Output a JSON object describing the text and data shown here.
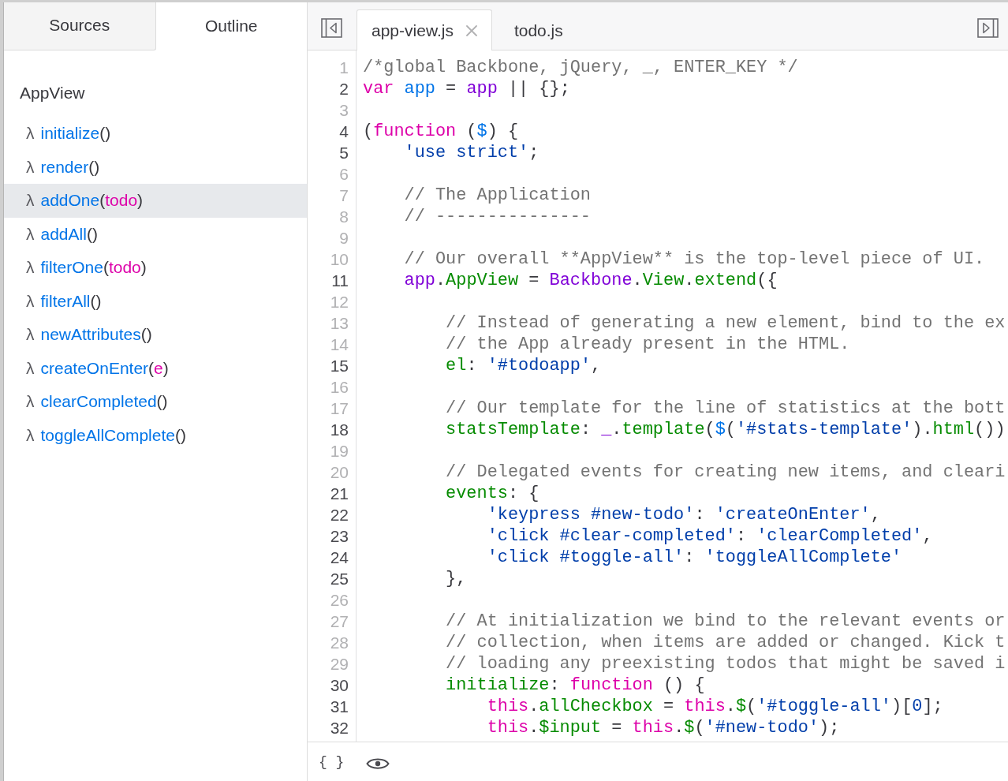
{
  "sidebar": {
    "tabs": [
      {
        "label": "Sources",
        "selected": false
      },
      {
        "label": "Outline",
        "selected": true
      }
    ],
    "outline": {
      "heading": "AppView",
      "functions": [
        {
          "symbol": "λ",
          "selected": false,
          "signature": [
            {
              "kind": "name",
              "text": "initialize"
            },
            {
              "kind": "punct",
              "text": "()"
            }
          ]
        },
        {
          "symbol": "λ",
          "selected": false,
          "signature": [
            {
              "kind": "name",
              "text": "render"
            },
            {
              "kind": "punct",
              "text": "()"
            }
          ]
        },
        {
          "symbol": "λ",
          "selected": true,
          "signature": [
            {
              "kind": "name",
              "text": "addOne"
            },
            {
              "kind": "punct",
              "text": "("
            },
            {
              "kind": "param",
              "text": "todo"
            },
            {
              "kind": "punct",
              "text": ")"
            }
          ]
        },
        {
          "symbol": "λ",
          "selected": false,
          "signature": [
            {
              "kind": "name",
              "text": "addAll"
            },
            {
              "kind": "punct",
              "text": "()"
            }
          ]
        },
        {
          "symbol": "λ",
          "selected": false,
          "signature": [
            {
              "kind": "name",
              "text": "filterOne"
            },
            {
              "kind": "punct",
              "text": "("
            },
            {
              "kind": "param",
              "text": "todo"
            },
            {
              "kind": "punct",
              "text": ")"
            }
          ]
        },
        {
          "symbol": "λ",
          "selected": false,
          "signature": [
            {
              "kind": "name",
              "text": "filterAll"
            },
            {
              "kind": "punct",
              "text": "()"
            }
          ]
        },
        {
          "symbol": "λ",
          "selected": false,
          "signature": [
            {
              "kind": "name",
              "text": "newAttributes"
            },
            {
              "kind": "punct",
              "text": "()"
            }
          ]
        },
        {
          "symbol": "λ",
          "selected": false,
          "signature": [
            {
              "kind": "name",
              "text": "createOnEnter"
            },
            {
              "kind": "punct",
              "text": "("
            },
            {
              "kind": "param",
              "text": "e"
            },
            {
              "kind": "punct",
              "text": ")"
            }
          ]
        },
        {
          "symbol": "λ",
          "selected": false,
          "signature": [
            {
              "kind": "name",
              "text": "clearCompleted"
            },
            {
              "kind": "punct",
              "text": "()"
            }
          ]
        },
        {
          "symbol": "λ",
          "selected": false,
          "signature": [
            {
              "kind": "name",
              "text": "toggleAllComplete"
            },
            {
              "kind": "punct",
              "text": "()"
            }
          ]
        }
      ]
    }
  },
  "editor": {
    "tabs": [
      {
        "label": "app-view.js",
        "selected": true
      },
      {
        "label": "todo.js",
        "selected": false
      }
    ],
    "lines": [
      {
        "number": "1",
        "executable": false,
        "tokens": [
          {
            "kind": "comment",
            "text": "/*global Backbone, jQuery, _, ENTER_KEY */"
          }
        ]
      },
      {
        "number": "2",
        "executable": true,
        "tokens": [
          {
            "kind": "keyword",
            "text": "var "
          },
          {
            "kind": "def",
            "text": "app"
          },
          {
            "kind": "plain",
            "text": " = "
          },
          {
            "kind": "variable",
            "text": "app"
          },
          {
            "kind": "plain",
            "text": " || {};"
          }
        ]
      },
      {
        "number": "3",
        "executable": false
      },
      {
        "number": "4",
        "executable": true,
        "tokens": [
          {
            "kind": "plain",
            "text": "("
          },
          {
            "kind": "keyword",
            "text": "function"
          },
          {
            "kind": "plain",
            "text": " ("
          },
          {
            "kind": "def",
            "text": "$"
          },
          {
            "kind": "plain",
            "text": ") {"
          }
        ]
      },
      {
        "number": "5",
        "executable": true,
        "tokens": [
          {
            "kind": "string",
            "text": "    'use strict'"
          },
          {
            "kind": "plain",
            "text": ";"
          }
        ]
      },
      {
        "number": "6",
        "executable": false
      },
      {
        "number": "7",
        "executable": false,
        "tokens": [
          {
            "kind": "comment",
            "text": "    // The Application"
          }
        ]
      },
      {
        "number": "8",
        "executable": false,
        "tokens": [
          {
            "kind": "comment",
            "text": "    // ---------------"
          }
        ]
      },
      {
        "number": "9",
        "executable": false
      },
      {
        "number": "10",
        "executable": false,
        "tokens": [
          {
            "kind": "comment",
            "text": "    // Our overall **AppView** is the top-level piece of UI."
          }
        ]
      },
      {
        "number": "11",
        "executable": true,
        "tokens": [
          {
            "kind": "variable",
            "text": "    app"
          },
          {
            "kind": "plain",
            "text": "."
          },
          {
            "kind": "property",
            "text": "AppView"
          },
          {
            "kind": "plain",
            "text": " = "
          },
          {
            "kind": "variable",
            "text": "Backbone"
          },
          {
            "kind": "plain",
            "text": "."
          },
          {
            "kind": "property",
            "text": "View"
          },
          {
            "kind": "plain",
            "text": "."
          },
          {
            "kind": "property",
            "text": "extend"
          },
          {
            "kind": "plain",
            "text": "({"
          }
        ]
      },
      {
        "number": "12",
        "executable": false
      },
      {
        "number": "13",
        "executable": false,
        "tokens": [
          {
            "kind": "comment",
            "text": "        // Instead of generating a new element, bind to the ex"
          }
        ]
      },
      {
        "number": "14",
        "executable": false,
        "tokens": [
          {
            "kind": "comment",
            "text": "        // the App already present in the HTML."
          }
        ]
      },
      {
        "number": "15",
        "executable": true,
        "tokens": [
          {
            "kind": "property",
            "text": "        el"
          },
          {
            "kind": "plain",
            "text": ": "
          },
          {
            "kind": "string",
            "text": "'#todoapp'"
          },
          {
            "kind": "plain",
            "text": ","
          }
        ]
      },
      {
        "number": "16",
        "executable": false
      },
      {
        "number": "17",
        "executable": false,
        "tokens": [
          {
            "kind": "comment",
            "text": "        // Our template for the line of statistics at the bott"
          }
        ]
      },
      {
        "number": "18",
        "executable": true,
        "tokens": [
          {
            "kind": "property",
            "text": "        statsTemplate"
          },
          {
            "kind": "plain",
            "text": ": "
          },
          {
            "kind": "variable",
            "text": "_"
          },
          {
            "kind": "plain",
            "text": "."
          },
          {
            "kind": "property",
            "text": "template"
          },
          {
            "kind": "plain",
            "text": "("
          },
          {
            "kind": "def",
            "text": "$"
          },
          {
            "kind": "plain",
            "text": "("
          },
          {
            "kind": "string",
            "text": "'#stats-template'"
          },
          {
            "kind": "plain",
            "text": ")."
          },
          {
            "kind": "property",
            "text": "html"
          },
          {
            "kind": "plain",
            "text": "())"
          }
        ]
      },
      {
        "number": "19",
        "executable": false
      },
      {
        "number": "20",
        "executable": false,
        "tokens": [
          {
            "kind": "comment",
            "text": "        // Delegated events for creating new items, and cleari"
          }
        ]
      },
      {
        "number": "21",
        "executable": true,
        "tokens": [
          {
            "kind": "property",
            "text": "        events"
          },
          {
            "kind": "plain",
            "text": ": {"
          }
        ]
      },
      {
        "number": "22",
        "executable": true,
        "tokens": [
          {
            "kind": "string",
            "text": "            'keypress #new-todo'"
          },
          {
            "kind": "plain",
            "text": ": "
          },
          {
            "kind": "string",
            "text": "'createOnEnter'"
          },
          {
            "kind": "plain",
            "text": ","
          }
        ]
      },
      {
        "number": "23",
        "executable": true,
        "tokens": [
          {
            "kind": "string",
            "text": "            'click #clear-completed'"
          },
          {
            "kind": "plain",
            "text": ": "
          },
          {
            "kind": "string",
            "text": "'clearCompleted'"
          },
          {
            "kind": "plain",
            "text": ","
          }
        ]
      },
      {
        "number": "24",
        "executable": true,
        "tokens": [
          {
            "kind": "string",
            "text": "            'click #toggle-all'"
          },
          {
            "kind": "plain",
            "text": ": "
          },
          {
            "kind": "string",
            "text": "'toggleAllComplete'"
          }
        ]
      },
      {
        "number": "25",
        "executable": true,
        "tokens": [
          {
            "kind": "plain",
            "text": "        },"
          }
        ]
      },
      {
        "number": "26",
        "executable": false
      },
      {
        "number": "27",
        "executable": false,
        "tokens": [
          {
            "kind": "comment",
            "text": "        // At initialization we bind to the relevant events or"
          }
        ]
      },
      {
        "number": "28",
        "executable": false,
        "tokens": [
          {
            "kind": "comment",
            "text": "        // collection, when items are added or changed. Kick t"
          }
        ]
      },
      {
        "number": "29",
        "executable": false,
        "tokens": [
          {
            "kind": "comment",
            "text": "        // loading any preexisting todos that might be saved i"
          }
        ]
      },
      {
        "number": "30",
        "executable": true,
        "tokens": [
          {
            "kind": "property",
            "text": "        initialize"
          },
          {
            "kind": "plain",
            "text": ": "
          },
          {
            "kind": "keyword",
            "text": "function"
          },
          {
            "kind": "plain",
            "text": " () {"
          }
        ]
      },
      {
        "number": "31",
        "executable": true,
        "tokens": [
          {
            "kind": "keyword",
            "text": "            this"
          },
          {
            "kind": "plain",
            "text": "."
          },
          {
            "kind": "property",
            "text": "allCheckbox"
          },
          {
            "kind": "plain",
            "text": " = "
          },
          {
            "kind": "keyword",
            "text": "this"
          },
          {
            "kind": "plain",
            "text": "."
          },
          {
            "kind": "property",
            "text": "$"
          },
          {
            "kind": "plain",
            "text": "("
          },
          {
            "kind": "string",
            "text": "'#toggle-all'"
          },
          {
            "kind": "plain",
            "text": ")["
          },
          {
            "kind": "number",
            "text": "0"
          },
          {
            "kind": "plain",
            "text": "];"
          }
        ]
      },
      {
        "number": "32",
        "executable": true,
        "tokens": [
          {
            "kind": "keyword",
            "text": "            this"
          },
          {
            "kind": "plain",
            "text": "."
          },
          {
            "kind": "property",
            "text": "$input"
          },
          {
            "kind": "plain",
            "text": " = "
          },
          {
            "kind": "keyword",
            "text": "this"
          },
          {
            "kind": "plain",
            "text": "."
          },
          {
            "kind": "property",
            "text": "$"
          },
          {
            "kind": "plain",
            "text": "("
          },
          {
            "kind": "string",
            "text": "'#new-todo'"
          },
          {
            "kind": "plain",
            "text": ");"
          }
        ]
      }
    ]
  },
  "footer": {
    "pretty_print": "{ }"
  }
}
